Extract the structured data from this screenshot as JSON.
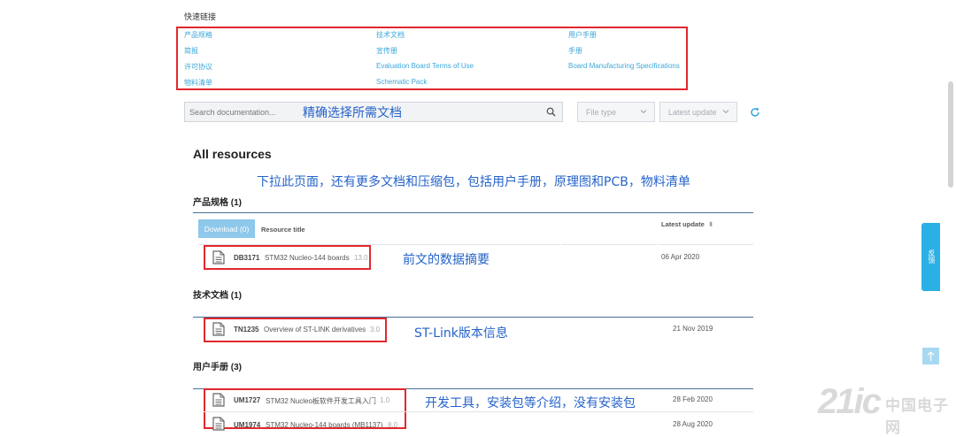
{
  "quick_links": {
    "title": "快速链接",
    "items": [
      "产品规格",
      "技术文档",
      "用户手册",
      "简报",
      "宣传册",
      "手册",
      "许可协议",
      "Evaluation Board Terms of Use",
      "Board Manufacturing Specifications",
      "物料清单",
      "Schematic Pack"
    ]
  },
  "search": {
    "placeholder": "Search documentation..."
  },
  "filters": {
    "file_type": "File type",
    "latest_update": "Latest update"
  },
  "annotations": {
    "search": "精确选择所需文档",
    "scroll": "下拉此页面，还有更多文档和压缩包，包括用户手册，原理图和PCB，物料清单",
    "datasheet": "前文的数据摘要",
    "stlink": "ST-Link版本信息",
    "devtools": "开发工具，安装包等介绍，没有安装包"
  },
  "resources": {
    "heading": "All resources",
    "download_label": "Download (0)",
    "col_title": "Resource title",
    "col_update": "Latest update",
    "sections": [
      {
        "title": "产品规格 (1)",
        "rows": [
          {
            "code": "DB3171",
            "title": "STM32 Nucleo-144 boards",
            "version": "13.0",
            "date": "06 Apr 2020"
          }
        ]
      },
      {
        "title": "技术文档 (1)",
        "rows": [
          {
            "code": "TN1235",
            "title": "Overview of ST-LINK derivatives",
            "version": "3.0",
            "date": "21 Nov 2019"
          }
        ]
      },
      {
        "title": "用户手册 (3)",
        "rows": [
          {
            "code": "UM1727",
            "title": "STM32 Nucleo板软件开发工具入门",
            "version": "1.0",
            "date": "28 Feb 2020"
          },
          {
            "code": "UM1974",
            "title": "STM32 Nucleo-144 boards (MB1137)",
            "version": "8.0",
            "date": "28 Aug 2020"
          }
        ]
      }
    ]
  },
  "side": {
    "feedback": "反馈"
  },
  "watermark": {
    "logo": "21ic",
    "site": "中国电子网"
  }
}
